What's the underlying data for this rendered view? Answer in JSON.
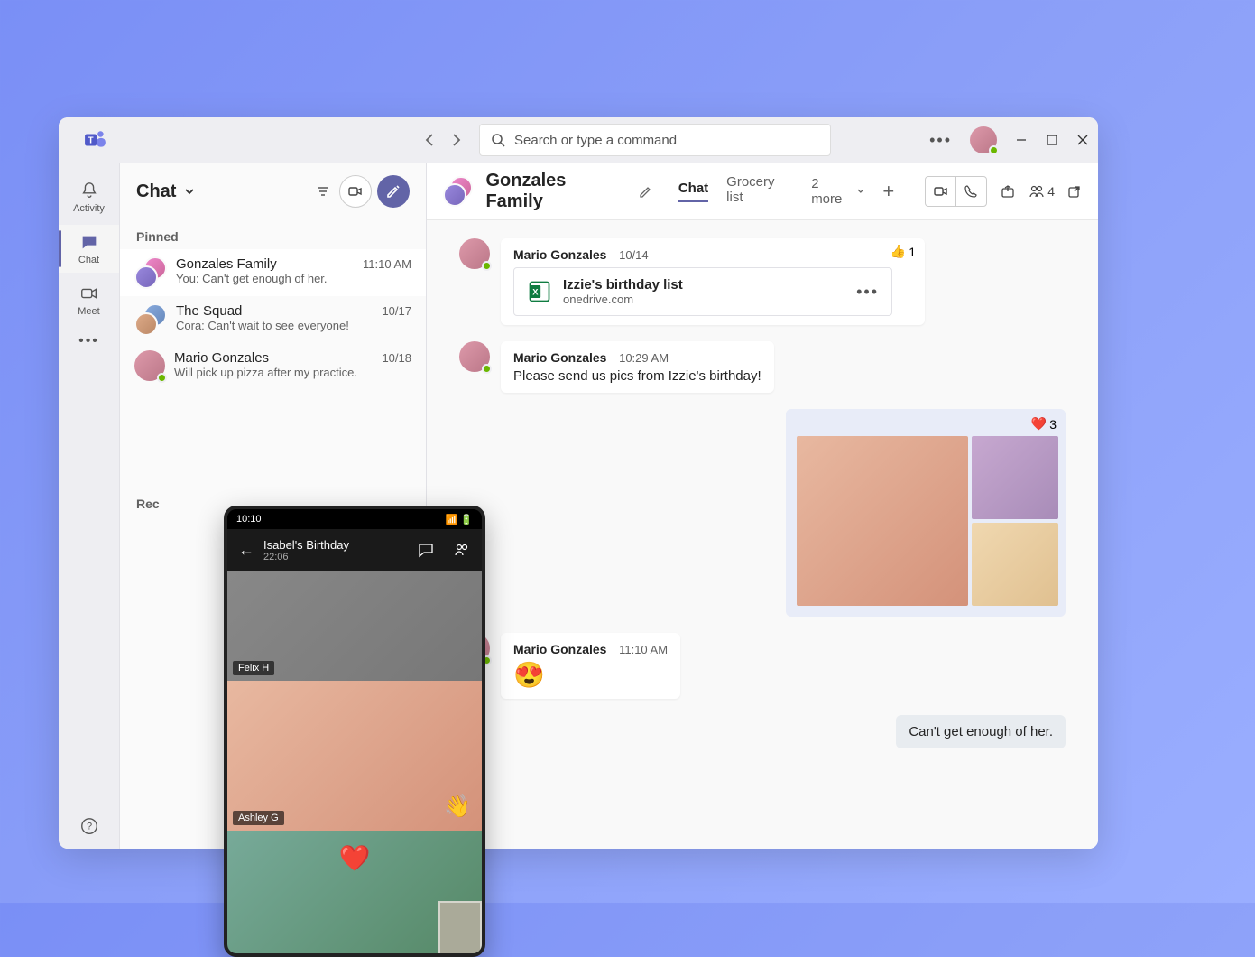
{
  "titlebar": {
    "search_placeholder": "Search or type a command"
  },
  "rail": {
    "activity": "Activity",
    "chat": "Chat",
    "meet": "Meet"
  },
  "chatlist": {
    "title": "Chat",
    "pinned_label": "Pinned",
    "recent_label": "Recent",
    "items": [
      {
        "name": "Gonzales Family",
        "preview": "You: Can't get enough of her.",
        "time": "11:10 AM"
      },
      {
        "name": "The Squad",
        "preview": "Cora: Can't wait to see everyone!",
        "time": "10/17"
      },
      {
        "name": "Mario Gonzales",
        "preview": "Will pick up pizza after my practice.",
        "time": "10/18"
      }
    ]
  },
  "conversation": {
    "title": "Gonzales Family",
    "tabs": {
      "chat": "Chat",
      "grocery": "Grocery list",
      "more": "2 more"
    },
    "participants": "4",
    "messages": [
      {
        "sender": "Mario Gonzales",
        "time": "10/14",
        "reaction_emoji": "👍",
        "reaction_count": "1",
        "file": {
          "name": "Izzie's birthday list",
          "source": "onedrive.com"
        }
      },
      {
        "sender": "Mario Gonzales",
        "time": "10:29 AM",
        "text": "Please send us pics from Izzie's birthday!"
      },
      {
        "reaction_emoji": "❤️",
        "reaction_count": "3"
      },
      {
        "sender": "Mario Gonzales",
        "time": "11:10 AM",
        "emoji": "😍"
      },
      {
        "out_text": "Can't get enough of her."
      }
    ]
  },
  "phone": {
    "clock": "10:10",
    "call_title": "Isabel's Birthday",
    "call_time": "22:06",
    "tile1_label": "Felix H",
    "tile2_label": "Ashley G"
  }
}
